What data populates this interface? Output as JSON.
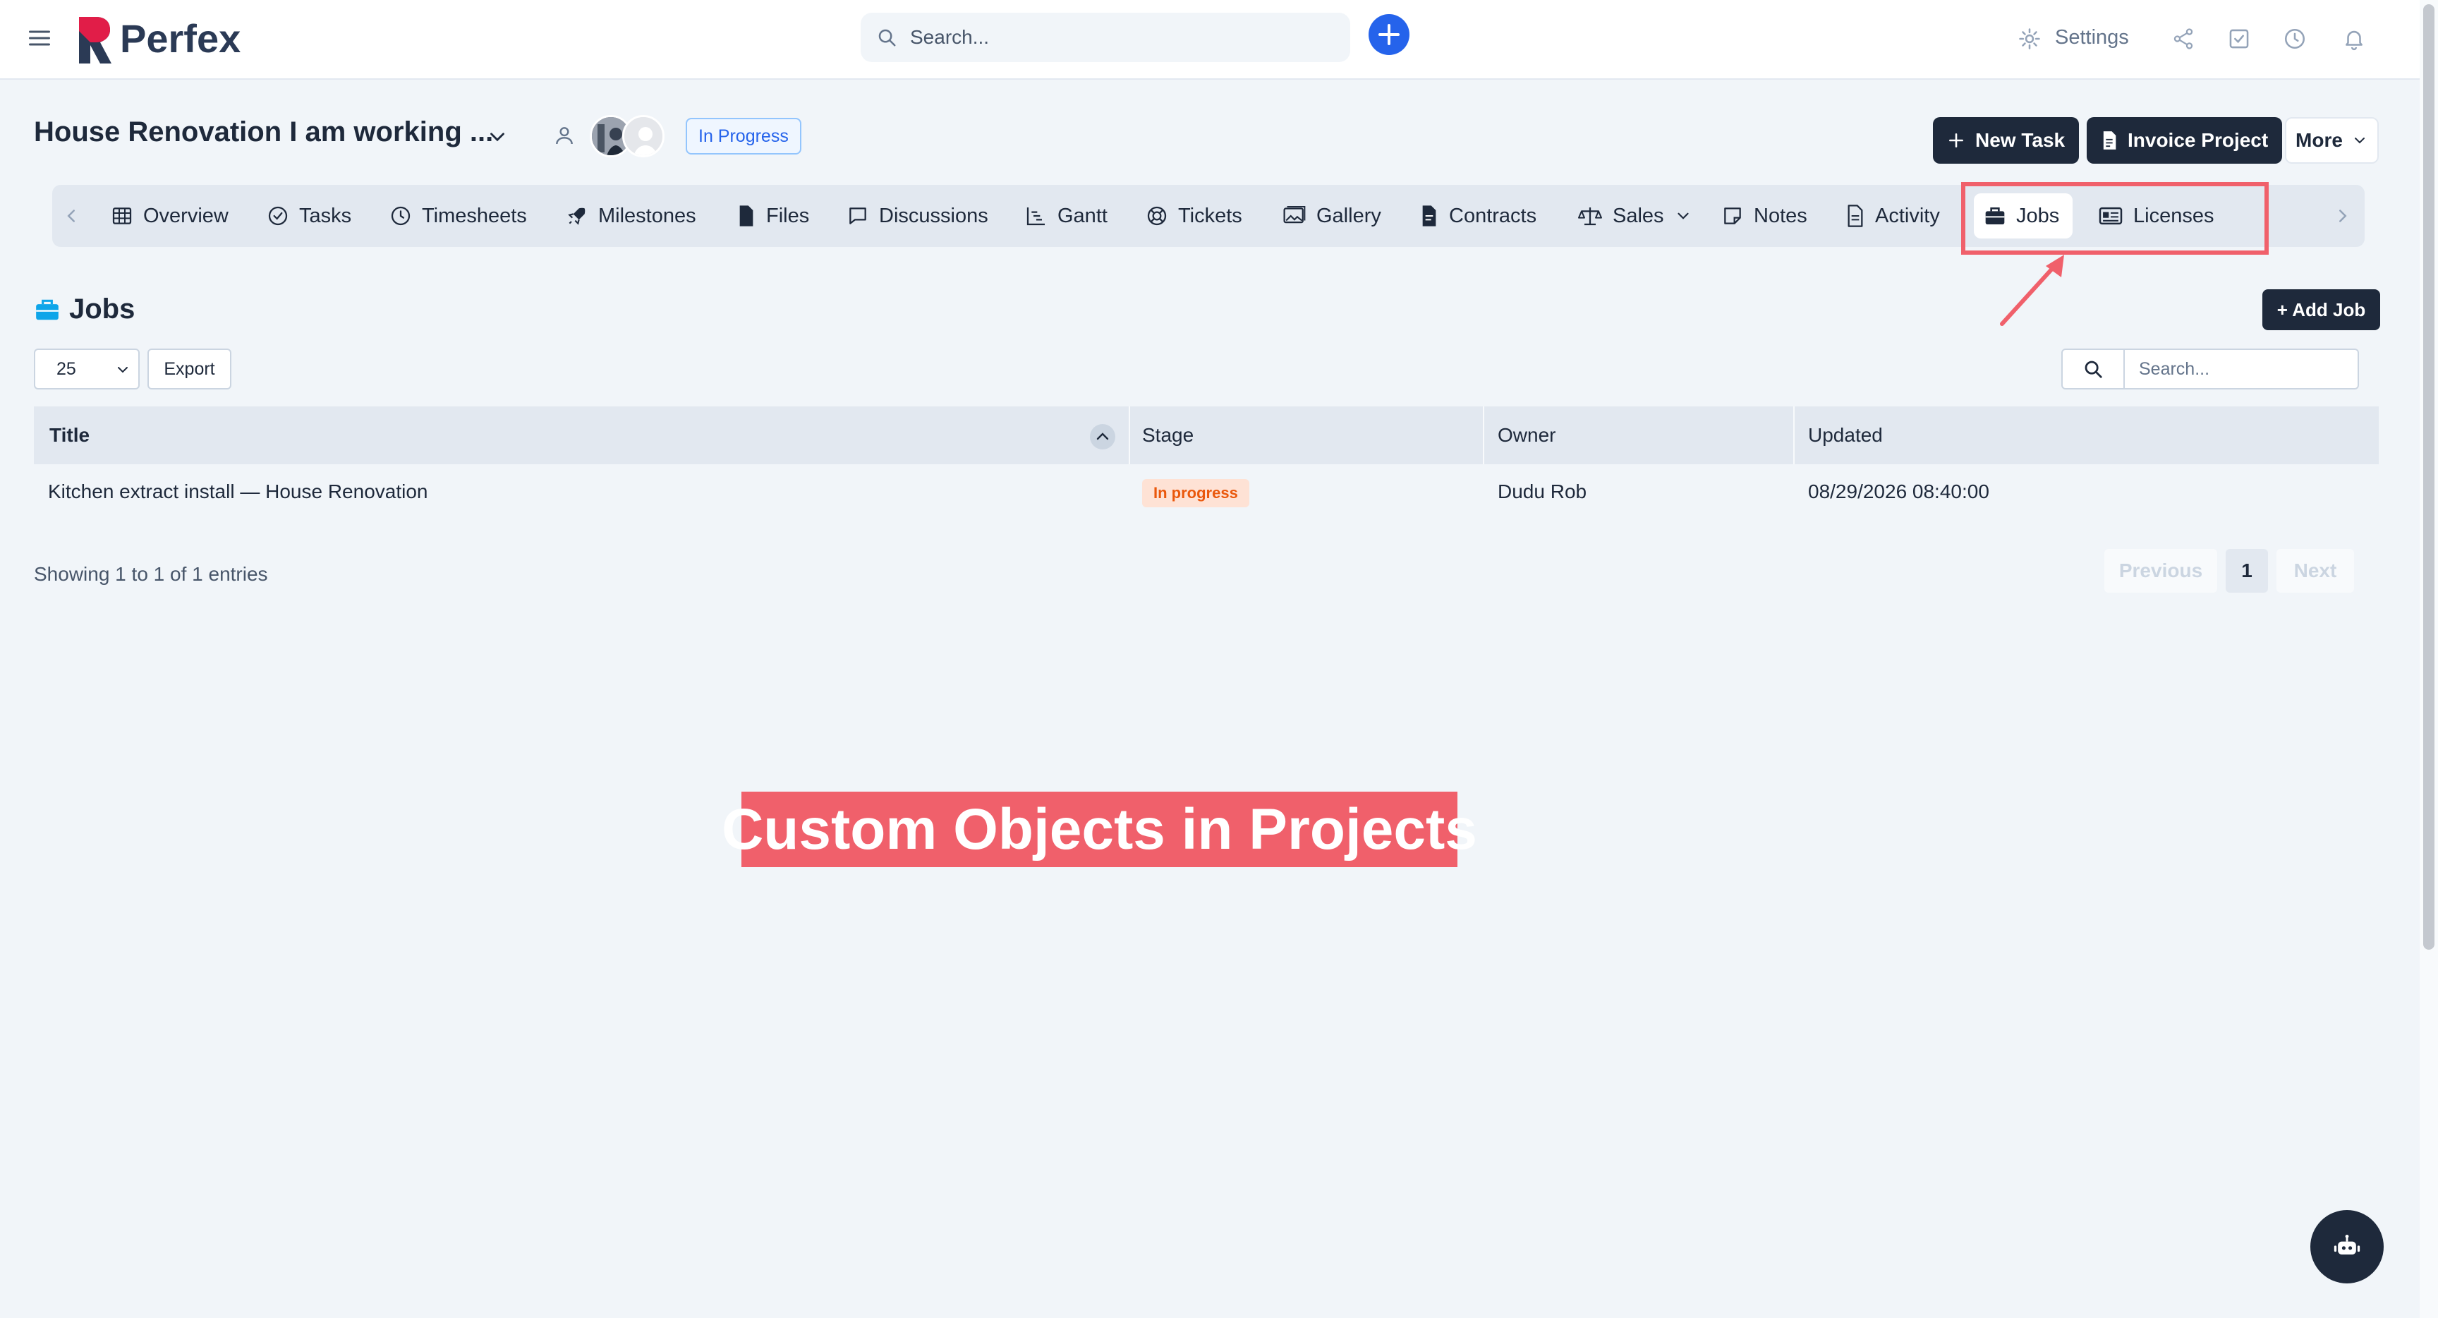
{
  "app": {
    "brand": "Perfex"
  },
  "topbar": {
    "search_placeholder": "Search...",
    "settings_label": "Settings"
  },
  "project": {
    "title": "House Renovation I am working ...",
    "status": "In Progress"
  },
  "header_actions": {
    "new_task": "New Task",
    "invoice_project": "Invoice Project",
    "more": "More"
  },
  "tabs": [
    {
      "label": "Overview",
      "icon": "table-icon"
    },
    {
      "label": "Tasks",
      "icon": "check-circle-icon"
    },
    {
      "label": "Timesheets",
      "icon": "clock-icon"
    },
    {
      "label": "Milestones",
      "icon": "rocket-icon"
    },
    {
      "label": "Files",
      "icon": "file-icon"
    },
    {
      "label": "Discussions",
      "icon": "chat-icon"
    },
    {
      "label": "Gantt",
      "icon": "gantt-chart-icon"
    },
    {
      "label": "Tickets",
      "icon": "lifebuoy-icon"
    },
    {
      "label": "Gallery",
      "icon": "image-icon"
    },
    {
      "label": "Contracts",
      "icon": "contract-icon"
    },
    {
      "label": "Sales",
      "icon": "scale-icon"
    },
    {
      "label": "Notes",
      "icon": "note-icon"
    },
    {
      "label": "Activity",
      "icon": "document-icon"
    },
    {
      "label": "Jobs",
      "icon": "briefcase-icon",
      "active": true
    },
    {
      "label": "Licenses",
      "icon": "id-card-icon"
    }
  ],
  "jobs": {
    "heading": "Jobs",
    "add_button": "+ Add Job",
    "page_length": "25",
    "export_label": "Export",
    "search_placeholder": "Search...",
    "columns": [
      "Title",
      "Stage",
      "Owner",
      "Updated"
    ],
    "rows": [
      {
        "title": "Kitchen extract install — House Renovation",
        "stage": "In progress",
        "owner": "Dudu Rob",
        "updated": "08/29/2026 08:40:00"
      }
    ],
    "showing": "Showing 1 to 1 of 1 entries",
    "pagination": {
      "previous": "Previous",
      "current": "1",
      "next": "Next"
    }
  },
  "annotation": {
    "banner": "Custom Objects in Projects"
  },
  "colors": {
    "accent": "#2563eb",
    "dark": "#1e293b",
    "highlight": "#f0606b",
    "stage_badge_bg": "#fee2d5",
    "stage_badge_text": "#ea580c"
  }
}
